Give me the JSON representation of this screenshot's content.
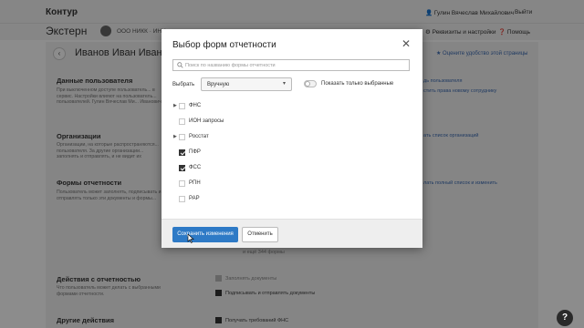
{
  "header": {
    "brand": "Контур",
    "user": "Гулин Вячеслав Михайлович",
    "logout": "Выйти"
  },
  "subheader": {
    "app_name": "Экстерн",
    "org_name": "ООО НИКК · ИНН",
    "requisites": "Реквизиты и настройки",
    "help": "Помощь"
  },
  "page": {
    "back_icon": "arrow-left-icon",
    "person_name": "Иванов Иван Иванов",
    "rate_link": "Оцените удобство этой страницы",
    "sections": [
      {
        "title": "Данные пользователя",
        "desc": "При выключенном доступе пользователь... в сервис. Настройки влияют на пользователь... пользователей. Гулин Вячеслав Ми... Иванович.",
        "link": "дь пользователя",
        "link2": "стить права новому сотруднику"
      },
      {
        "title": "Организации",
        "desc": "Организации, на которые распространяются... пользователя. За другие организации... заполнять и отправлять, и не видит их документы.",
        "link": "ать список организаций"
      },
      {
        "title": "Формы отчетности",
        "desc": "Пользователь может заполнять, подписывать и... отправлять только эти документы и формы...",
        "link": "лать полный список и изменить"
      },
      {
        "title": "Действия с отчетностью",
        "desc": "Что пользователь может делать с выбранными формами отчетности."
      },
      {
        "title": "Другие действия",
        "desc": ""
      }
    ],
    "bg_options": {
      "only_forms": "и ещё 344 формы",
      "fill": "Заполнять документы",
      "sign": "Подписывать и отправлять документы",
      "fns": "Получать требований ФНС"
    },
    "help_fab": "?"
  },
  "modal": {
    "title": "Выбор форм отчетности",
    "close_icon": "close-icon",
    "search_placeholder": "Поиск по названию формы отчетности",
    "search_value": "",
    "select_label": "Выбрать",
    "select_value": "Вручную",
    "toggle_label": "Показать только выбранные",
    "toggle_on": false,
    "items": [
      {
        "label": "ФНС",
        "expandable": true,
        "checked": false
      },
      {
        "label": "ИОН запросы",
        "expandable": false,
        "checked": false
      },
      {
        "label": "Росстат",
        "expandable": true,
        "checked": false
      },
      {
        "label": "ПФР",
        "expandable": false,
        "checked": true
      },
      {
        "label": "ФСС",
        "expandable": false,
        "checked": true
      },
      {
        "label": "РПН",
        "expandable": false,
        "checked": false
      },
      {
        "label": "РАР",
        "expandable": false,
        "checked": false
      }
    ],
    "save_label": "Сохранить изменения",
    "cancel_label": "Отменить"
  },
  "colors": {
    "accent": "#2e7ac6",
    "link": "#3d6cb3",
    "overlay": "rgba(0,0,0,0.45)"
  }
}
